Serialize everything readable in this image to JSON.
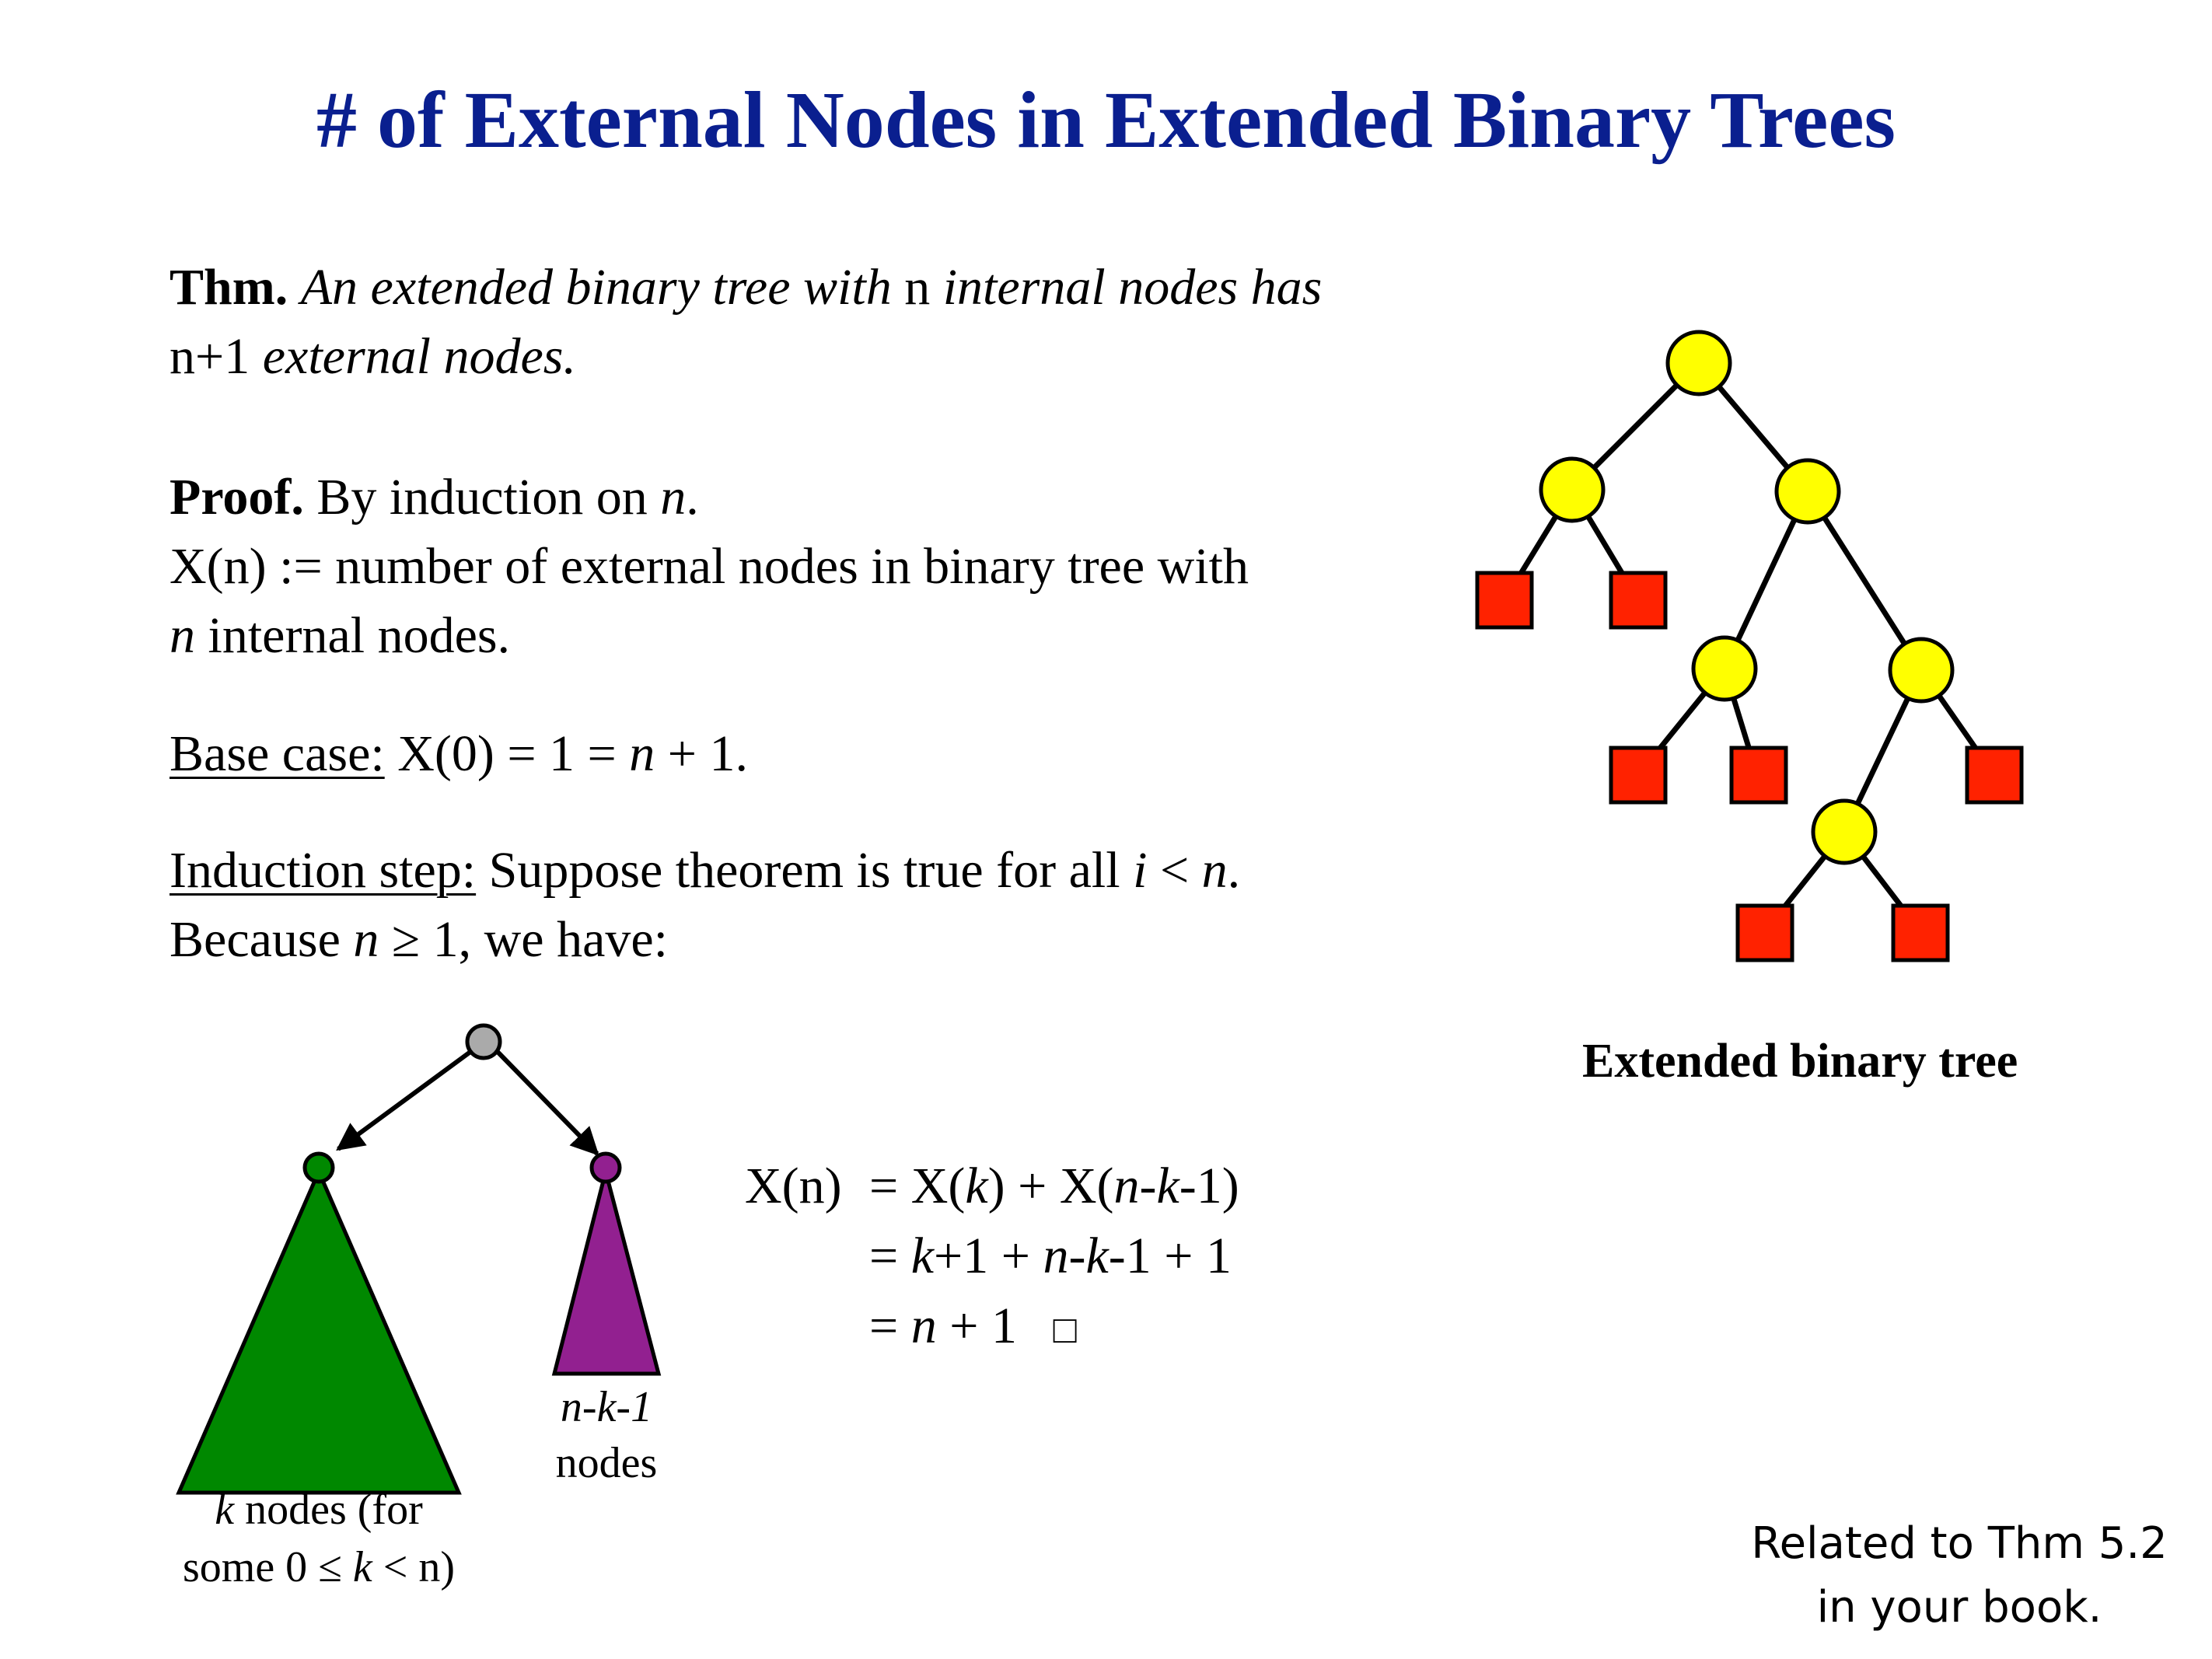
{
  "title": "# of External Nodes in Extended Binary Trees",
  "theorem": {
    "label": "Thm.",
    "text_a": "An extended binary tree with",
    "var_n": "n",
    "text_b": "internal nodes has",
    "line2_a": "n+1",
    "line2_b": "external nodes."
  },
  "proof": {
    "label": "Proof.",
    "text_a": "By induction on",
    "var_n": "n",
    "period": ".",
    "def_line1": "X(n) := number of external nodes in binary tree with",
    "def_line2_var": "n",
    "def_line2_rest": "internal nodes."
  },
  "base_case": {
    "label": "Base case:",
    "text_a": "X(0) = 1 =",
    "var_n": "n",
    "text_b": "+ 1."
  },
  "induction_step": {
    "label": "Induction step:",
    "text_a": "Suppose theorem is true for all",
    "var_i": "i",
    "lt": "<",
    "var_n": "n",
    "period": ".",
    "line2_a": "Because",
    "line2_var": "n",
    "line2_b": "≥ 1, we have:"
  },
  "equations": {
    "lhs": "X(n)",
    "line1": [
      "= X(",
      "k",
      ") + X(",
      "n",
      "-",
      "k",
      "-1)"
    ],
    "line2": [
      "=",
      "k",
      "+1 +",
      "n",
      "-",
      "k",
      "-1 + 1"
    ],
    "line3": [
      "=",
      "n",
      "+ 1"
    ],
    "qed": "□"
  },
  "subtree_labels": {
    "right_var_n": "n",
    "right_dash1": "-",
    "right_var_k": "k",
    "right_suffix": "-1",
    "right_line2": "nodes",
    "left_var_k": "k",
    "left_line1_rest": "nodes (for",
    "left_line2_a": "some 0 ≤",
    "left_line2_var_k": "k",
    "left_line2_b": "< n)"
  },
  "ebt_caption": "Extended binary tree",
  "book_note": {
    "line1": "Related to Thm 5.2",
    "line2": "in your book."
  },
  "colors": {
    "title": "#0a1f8f",
    "internal_node": "#ffff00",
    "external_node": "#ff2200",
    "root_node": "#aaaaaa",
    "left_subtree": "#008800",
    "right_subtree": "#922090"
  }
}
